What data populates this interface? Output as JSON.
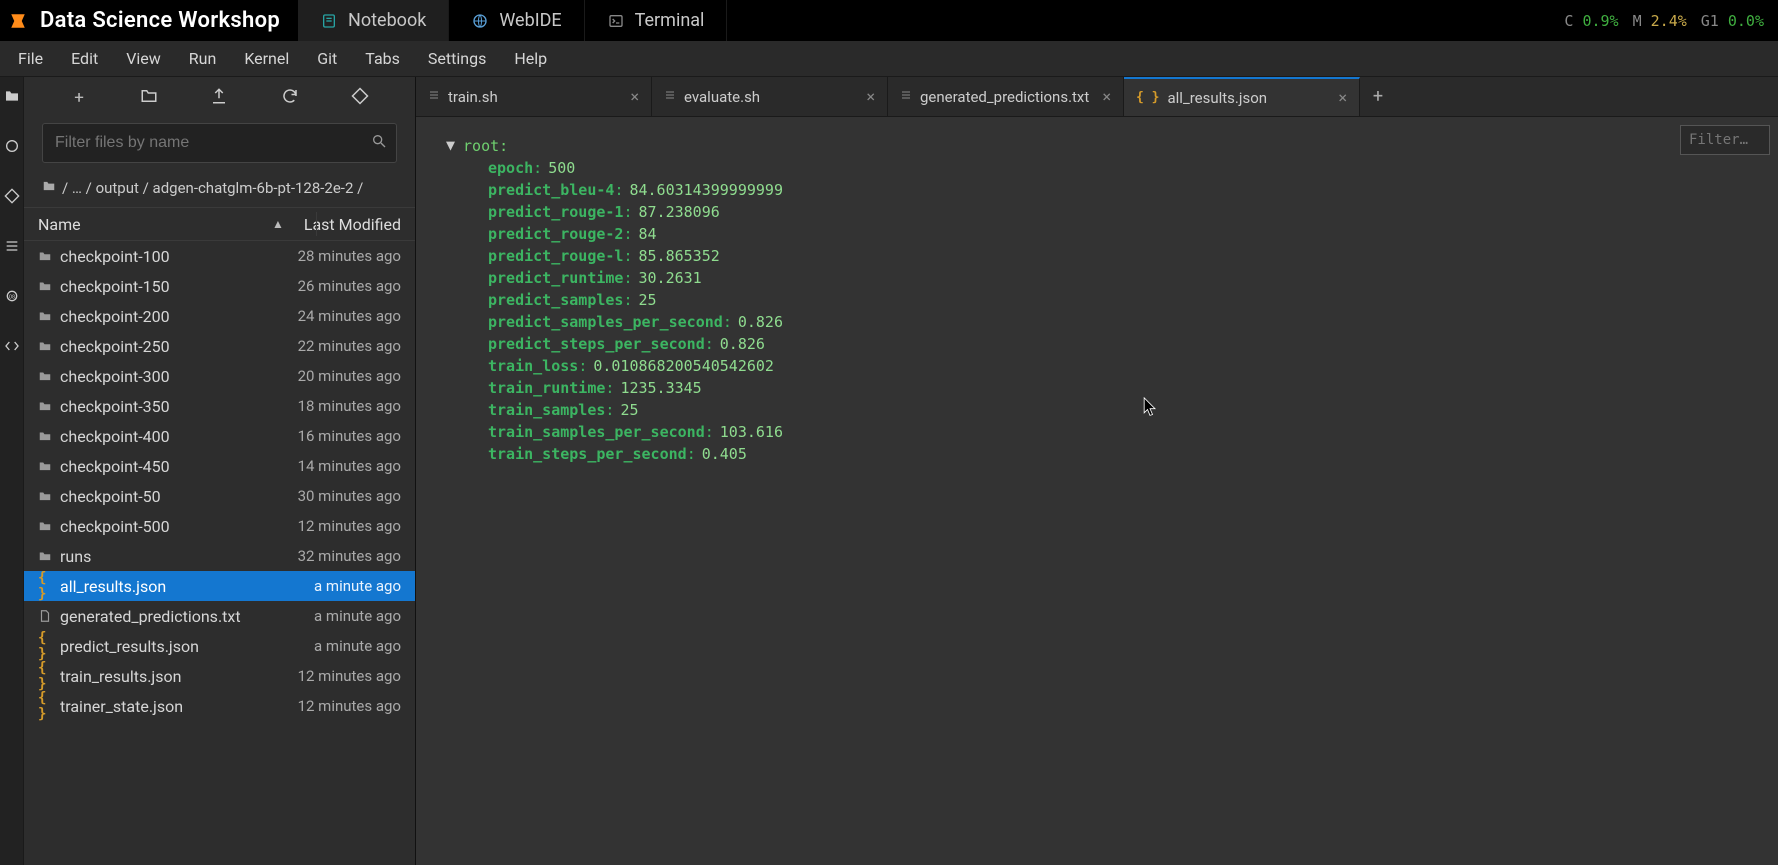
{
  "app": {
    "title": "Data Science Workshop"
  },
  "global_tabs": [
    {
      "label": "Notebook",
      "icon": "notebook",
      "active": true
    },
    {
      "label": "WebIDE",
      "icon": "webide",
      "active": false
    },
    {
      "label": "Terminal",
      "icon": "terminal",
      "active": false
    }
  ],
  "stats": {
    "c_label": "C",
    "c": "0.9%",
    "m_label": "M",
    "m": "2.4%",
    "g_label": "G1",
    "g": "0.0%"
  },
  "menu": [
    "File",
    "Edit",
    "View",
    "Run",
    "Kernel",
    "Git",
    "Tabs",
    "Settings",
    "Help"
  ],
  "filebrowser": {
    "search_placeholder": "Filter files by name",
    "breadcrumb": "/ … / output / adgen-chatglm-6b-pt-128-2e-2 /",
    "cols": {
      "name": "Name",
      "modified": "Last Modified"
    },
    "items": [
      {
        "type": "folder",
        "name": "checkpoint-100",
        "modified": "28 minutes ago"
      },
      {
        "type": "folder",
        "name": "checkpoint-150",
        "modified": "26 minutes ago"
      },
      {
        "type": "folder",
        "name": "checkpoint-200",
        "modified": "24 minutes ago"
      },
      {
        "type": "folder",
        "name": "checkpoint-250",
        "modified": "22 minutes ago"
      },
      {
        "type": "folder",
        "name": "checkpoint-300",
        "modified": "20 minutes ago"
      },
      {
        "type": "folder",
        "name": "checkpoint-350",
        "modified": "18 minutes ago"
      },
      {
        "type": "folder",
        "name": "checkpoint-400",
        "modified": "16 minutes ago"
      },
      {
        "type": "folder",
        "name": "checkpoint-450",
        "modified": "14 minutes ago"
      },
      {
        "type": "folder",
        "name": "checkpoint-50",
        "modified": "30 minutes ago"
      },
      {
        "type": "folder",
        "name": "checkpoint-500",
        "modified": "12 minutes ago"
      },
      {
        "type": "folder",
        "name": "runs",
        "modified": "32 minutes ago"
      },
      {
        "type": "json",
        "name": "all_results.json",
        "modified": "a minute ago",
        "selected": true
      },
      {
        "type": "file",
        "name": "generated_predictions.txt",
        "modified": "a minute ago"
      },
      {
        "type": "json",
        "name": "predict_results.json",
        "modified": "a minute ago"
      },
      {
        "type": "json",
        "name": "train_results.json",
        "modified": "12 minutes ago"
      },
      {
        "type": "json",
        "name": "trainer_state.json",
        "modified": "12 minutes ago"
      }
    ]
  },
  "editor_tabs": [
    {
      "label": "train.sh",
      "icon": "file",
      "active": false
    },
    {
      "label": "evaluate.sh",
      "icon": "file",
      "active": false
    },
    {
      "label": "generated_predictions.txt",
      "icon": "file",
      "active": false
    },
    {
      "label": "all_results.json",
      "icon": "json",
      "active": true
    }
  ],
  "json_filter_placeholder": "Filter…",
  "json_root_label": "root:",
  "json_content": [
    {
      "k": "epoch",
      "v": "500"
    },
    {
      "k": "predict_bleu-4",
      "v": "84.60314399999999"
    },
    {
      "k": "predict_rouge-1",
      "v": "87.238096"
    },
    {
      "k": "predict_rouge-2",
      "v": "84"
    },
    {
      "k": "predict_rouge-l",
      "v": "85.865352"
    },
    {
      "k": "predict_runtime",
      "v": "30.2631"
    },
    {
      "k": "predict_samples",
      "v": "25"
    },
    {
      "k": "predict_samples_per_second",
      "v": "0.826"
    },
    {
      "k": "predict_steps_per_second",
      "v": "0.826"
    },
    {
      "k": "train_loss",
      "v": "0.010868200540542602"
    },
    {
      "k": "train_runtime",
      "v": "1235.3345"
    },
    {
      "k": "train_samples",
      "v": "25"
    },
    {
      "k": "train_samples_per_second",
      "v": "103.616"
    },
    {
      "k": "train_steps_per_second",
      "v": "0.405"
    }
  ]
}
